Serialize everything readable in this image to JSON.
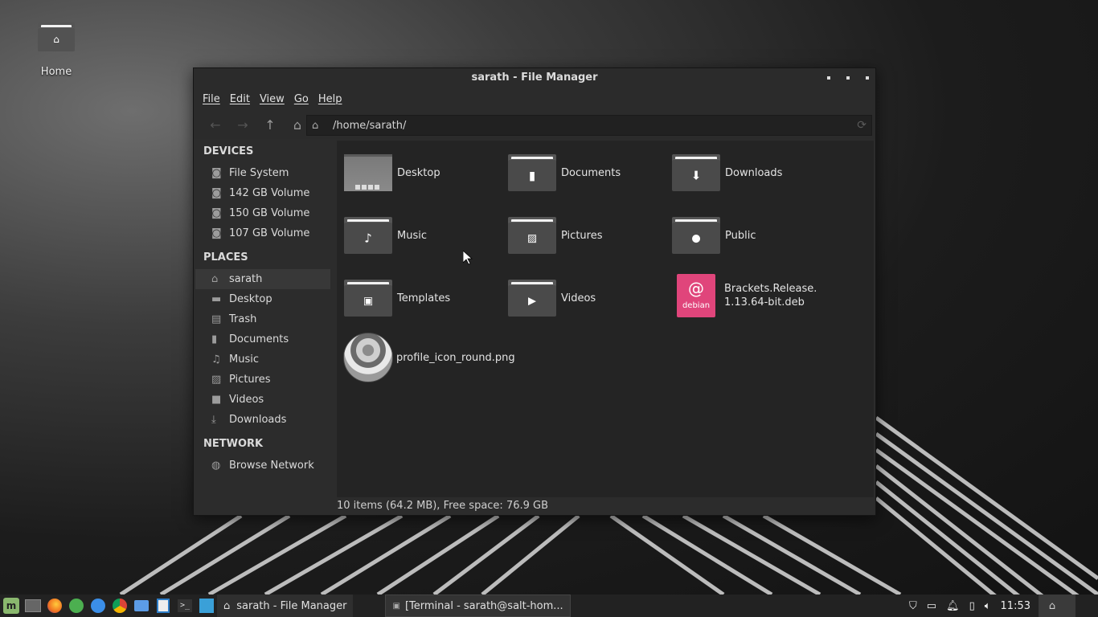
{
  "desktop": {
    "icons": [
      {
        "label": "Home",
        "icon": "home-folder-icon"
      }
    ]
  },
  "window": {
    "title": "sarath - File Manager",
    "menu": [
      "File",
      "Edit",
      "View",
      "Go",
      "Help"
    ],
    "toolbar": {
      "back": "←",
      "forward": "→",
      "up": "↑",
      "home": "⌂"
    },
    "address": "/home/sarath/",
    "sidebar": {
      "devices_header": "DEVICES",
      "devices": [
        {
          "label": "File System",
          "icon": "drive-icon"
        },
        {
          "label": "142 GB Volume",
          "icon": "drive-icon"
        },
        {
          "label": "150 GB Volume",
          "icon": "drive-icon"
        },
        {
          "label": "107 GB Volume",
          "icon": "drive-icon"
        }
      ],
      "places_header": "PLACES",
      "places": [
        {
          "label": "sarath",
          "icon": "home-icon",
          "active": true
        },
        {
          "label": "Desktop",
          "icon": "desktop-icon"
        },
        {
          "label": "Trash",
          "icon": "trash-icon"
        },
        {
          "label": "Documents",
          "icon": "document-icon"
        },
        {
          "label": "Music",
          "icon": "music-icon"
        },
        {
          "label": "Pictures",
          "icon": "picture-icon"
        },
        {
          "label": "Videos",
          "icon": "video-icon"
        },
        {
          "label": "Downloads",
          "icon": "download-icon"
        }
      ],
      "network_header": "NETWORK",
      "network": [
        {
          "label": "Browse Network",
          "icon": "network-icon"
        }
      ]
    },
    "items": [
      {
        "name": "Desktop",
        "type": "folder-thumb"
      },
      {
        "name": "Documents",
        "type": "folder",
        "emblem": "document-icon"
      },
      {
        "name": "Downloads",
        "type": "folder",
        "emblem": "download-icon"
      },
      {
        "name": "Music",
        "type": "folder",
        "emblem": "music-icon"
      },
      {
        "name": "Pictures",
        "type": "folder",
        "emblem": "picture-icon"
      },
      {
        "name": "Public",
        "type": "folder",
        "emblem": "person-icon"
      },
      {
        "name": "Templates",
        "type": "folder",
        "emblem": "template-icon"
      },
      {
        "name": "Videos",
        "type": "folder",
        "emblem": "play-icon"
      },
      {
        "name_line1": "Brackets.Release.",
        "name_line2": "1.13.64-bit.deb",
        "type": "deb",
        "badge": "debian"
      },
      {
        "name": "profile_icon_round.png",
        "type": "image"
      }
    ],
    "status": "10 items (64.2 MB), Free space: 76.9 GB"
  },
  "taskbar": {
    "launchers": [
      "menu-icon",
      "show-desktop-icon",
      "firefox-icon",
      "android-icon",
      "browser-icon",
      "chrome-icon",
      "video-call-icon",
      "app-icon",
      "terminal-icon",
      "app-icon-2"
    ],
    "windows": [
      {
        "label": "sarath - File Manager",
        "active": true
      },
      {
        "label": "[Terminal - sarath@salt-hom...",
        "active": false
      }
    ],
    "clock": "11:53"
  }
}
